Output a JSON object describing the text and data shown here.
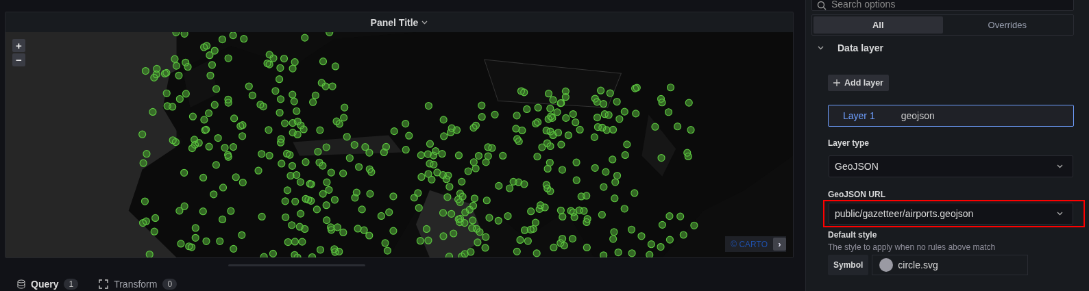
{
  "panel": {
    "title": "Panel Title"
  },
  "map": {
    "zoom_buttons": [
      "+",
      "−"
    ],
    "attribution": "© CARTO",
    "attribution_toggle": "›"
  },
  "bottom_tabs": [
    {
      "label": "Query",
      "count": "1",
      "selected": true
    },
    {
      "label": "Transform",
      "count": "0",
      "selected": false
    }
  ],
  "options": {
    "search": {
      "placeholder": "Search options"
    },
    "tabs": [
      {
        "label": "All",
        "selected": true
      },
      {
        "label": "Overrides",
        "selected": false
      }
    ],
    "section": {
      "title": "Data layer",
      "expanded": true
    },
    "add_layer": "Add layer",
    "layers": [
      {
        "name": "Layer 1",
        "type": "geojson",
        "selected": true
      }
    ],
    "fields": [
      {
        "kind": "select",
        "label": "Layer type",
        "value": "GeoJSON",
        "highlighted": false
      },
      {
        "kind": "select",
        "label": "GeoJSON URL",
        "value": "public/gazetteer/airports.geojson",
        "highlighted": true
      }
    ],
    "default_style": {
      "label": "Default style",
      "description": "The style to apply when no rules above match",
      "symbol_label": "Symbol",
      "symbol_value": "circle.svg"
    }
  }
}
